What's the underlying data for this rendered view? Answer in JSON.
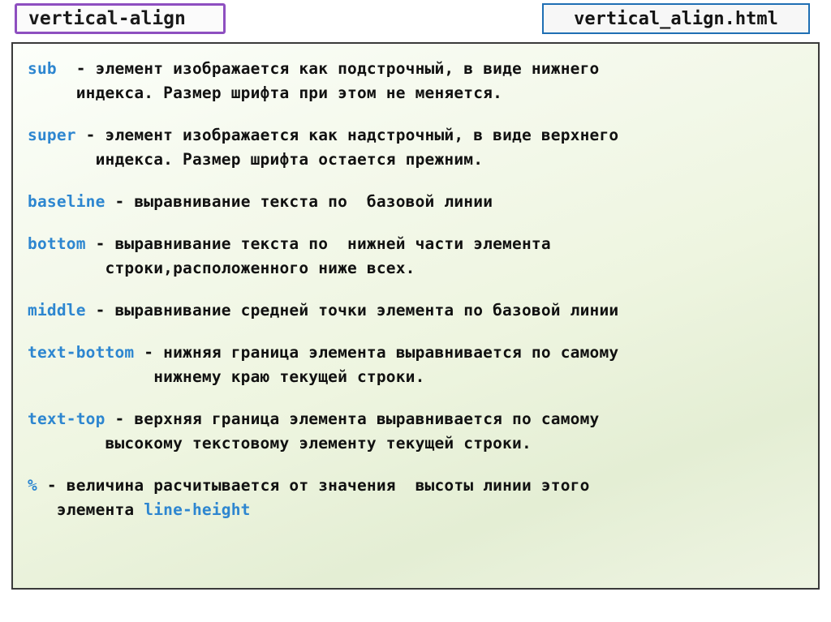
{
  "slide": {
    "title": "vertical-align",
    "file_name": "vertical_align.html",
    "title_border_color": "#8e4fc0",
    "file_border_color": "#1f6fb4",
    "keyword_color": "#2d86d0",
    "text_color": "#111111"
  },
  "properties": [
    {
      "keyword": "sub",
      "lines": [
        "  - элемент изображается как подстрочный, в виде нижнего",
        "     индекса. Размер шрифта при этом не меняется."
      ]
    },
    {
      "keyword": "super",
      "lines": [
        " - элемент изображается как надстрочный, в виде верхнего",
        "       индекса. Размер шрифта остается прежним."
      ]
    },
    {
      "keyword": "baseline",
      "lines": [
        " - выравнивание текста по  базовой линии"
      ]
    },
    {
      "keyword": "bottom",
      "lines": [
        " - выравнивание текста по  нижней части элемента",
        "        строки,расположенного ниже всех."
      ]
    },
    {
      "keyword": "middle",
      "lines": [
        " - выравнивание средней точки элемента по базовой линии"
      ]
    },
    {
      "keyword": "text-bottom",
      "lines": [
        " - нижняя граница элемента выравнивается по самому",
        "             нижнему краю текущей строки."
      ]
    },
    {
      "keyword": "text-top",
      "lines": [
        " - верхняя граница элемента выравнивается по самому",
        "        высокому текстовому элементу текущей строки."
      ]
    },
    {
      "keyword": "%",
      "lines": [
        " - величина расчитывается от значения  высоты линии этого",
        "   элемента "
      ],
      "trailing_keyword": "line-height"
    }
  ]
}
